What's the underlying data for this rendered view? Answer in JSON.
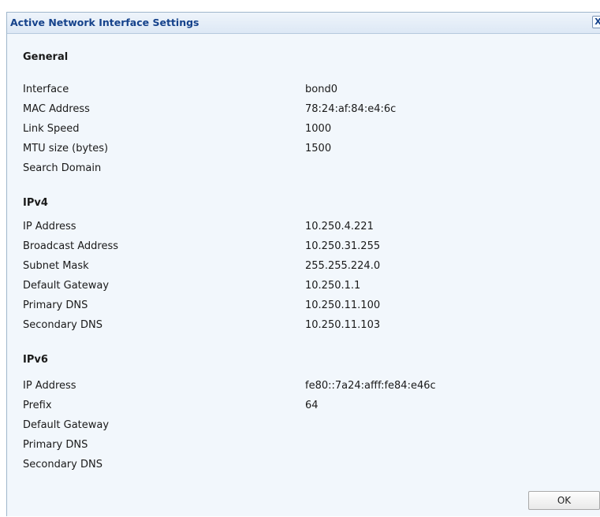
{
  "dialog": {
    "title": "Active Network Interface Settings",
    "close_label": "X",
    "ok_label": "OK"
  },
  "general": {
    "heading": "General",
    "rows": [
      {
        "label": "Interface",
        "value": "bond0"
      },
      {
        "label": "MAC Address",
        "value": "78:24:af:84:e4:6c"
      },
      {
        "label": "Link Speed",
        "value": "1000"
      },
      {
        "label": "MTU size (bytes)",
        "value": "1500"
      },
      {
        "label": "Search Domain",
        "value": ""
      }
    ]
  },
  "ipv4": {
    "heading": "IPv4",
    "rows": [
      {
        "label": "IP Address",
        "value": "10.250.4.221"
      },
      {
        "label": "Broadcast Address",
        "value": "10.250.31.255"
      },
      {
        "label": "Subnet Mask",
        "value": "255.255.224.0"
      },
      {
        "label": "Default Gateway",
        "value": "10.250.1.1"
      },
      {
        "label": "Primary DNS",
        "value": "10.250.11.100"
      },
      {
        "label": "Secondary DNS",
        "value": "10.250.11.103"
      }
    ]
  },
  "ipv6": {
    "heading": "IPv6",
    "rows": [
      {
        "label": "IP Address",
        "value": "fe80::7a24:afff:fe84:e46c"
      },
      {
        "label": "Prefix",
        "value": "64"
      },
      {
        "label": "Default Gateway",
        "value": ""
      },
      {
        "label": "Primary DNS",
        "value": ""
      },
      {
        "label": "Secondary DNS",
        "value": ""
      }
    ]
  }
}
